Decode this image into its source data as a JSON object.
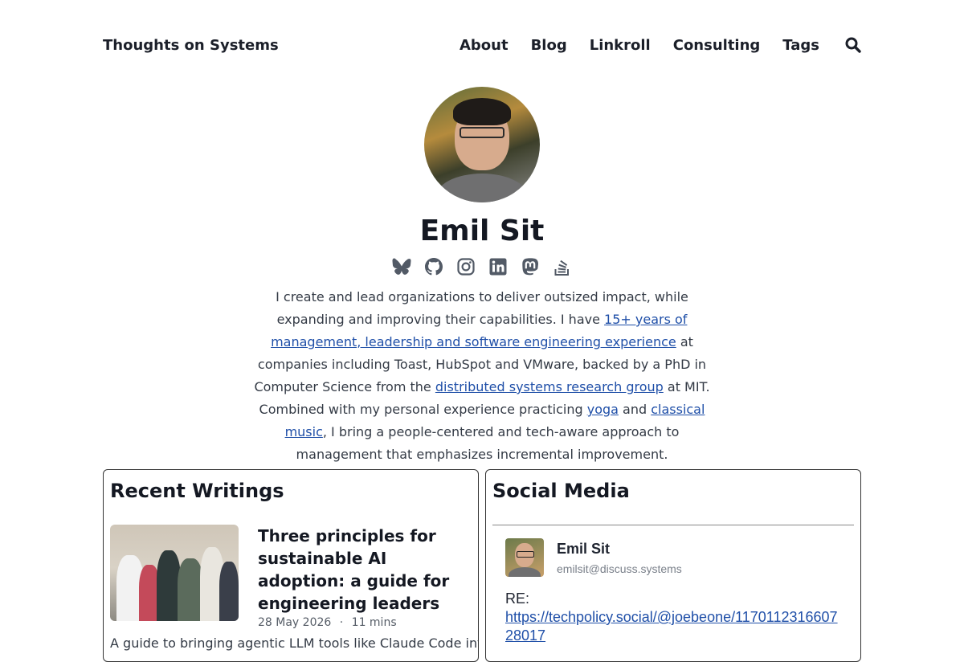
{
  "header": {
    "site_title": "Thoughts on Systems",
    "nav": [
      "About",
      "Blog",
      "Linkroll",
      "Consulting",
      "Tags"
    ],
    "search_icon": "search-icon"
  },
  "hero": {
    "name": "Emil Sit",
    "social_icons": [
      "bluesky-icon",
      "github-icon",
      "instagram-icon",
      "linkedin-icon",
      "mastodon-icon",
      "stackoverflow-icon"
    ],
    "bio": {
      "t1": "I create and lead organizations to deliver outsized impact, while expanding and improving their capabilities. I have ",
      "l1": "15+ years of management, leadership and software engineering experience",
      "t2": " at companies including Toast, HubSpot and VMware, backed by a PhD in Computer Science from the ",
      "l2": "distributed systems research group",
      "t3": " at MIT. Combined with my personal experience practicing ",
      "l3": "yoga",
      "t4": " and ",
      "l4": "classical music",
      "t5": ", I bring a people-centered and tech-aware approach to management that emphasizes incremental improvement."
    }
  },
  "recent": {
    "heading": "Recent Writings",
    "post": {
      "title": "Three principles for sustainable AI adoption: a guide for engineering leaders",
      "date": "28 May 2026",
      "sep": "·",
      "read_time": "11 mins",
      "summary": "A guide to bringing agentic LLM tools like Claude Code into"
    }
  },
  "social": {
    "heading": "Social Media",
    "toot": {
      "display_name": "Emil Sit",
      "handle": "emilsit@discuss.systems",
      "text": "RE:",
      "link": "https://techpolicy.social/@joebeone/117011231660728017"
    }
  },
  "colors": {
    "link": "#1f4fa8",
    "text": "#1f2430",
    "muted": "#555c66"
  }
}
